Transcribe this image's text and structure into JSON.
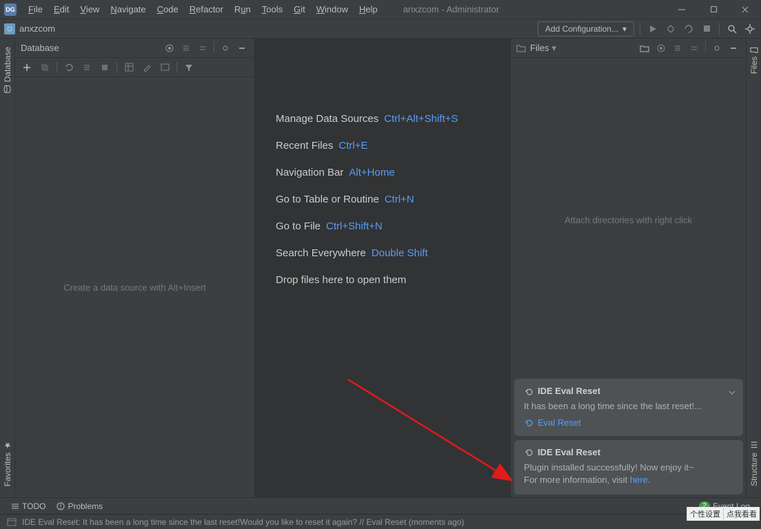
{
  "app_icon_text": "DG",
  "title": "anxzcom - Administrator",
  "menu": [
    "File",
    "Edit",
    "View",
    "Navigate",
    "Code",
    "Refactor",
    "Run",
    "Tools",
    "Git",
    "Window",
    "Help"
  ],
  "project_name": "anxzcom",
  "toolbar": {
    "config": "Add Configuration..."
  },
  "left_rail": {
    "database": "Database",
    "favorites": "Favorites"
  },
  "right_rail": {
    "files": "Files",
    "structure": "Structure"
  },
  "db_panel": {
    "title": "Database",
    "placeholder": "Create a data source with Alt+Insert"
  },
  "files_panel": {
    "title": "Files",
    "placeholder": "Attach directories with right click"
  },
  "tips": [
    {
      "label": "Manage Data Sources",
      "shortcut": "Ctrl+Alt+Shift+S"
    },
    {
      "label": "Recent Files",
      "shortcut": "Ctrl+E"
    },
    {
      "label": "Navigation Bar",
      "shortcut": "Alt+Home"
    },
    {
      "label": "Go to Table or Routine",
      "shortcut": "Ctrl+N"
    },
    {
      "label": "Go to File",
      "shortcut": "Ctrl+Shift+N"
    },
    {
      "label": "Search Everywhere",
      "shortcut": "Double Shift"
    },
    {
      "label": "Drop files here to open them",
      "shortcut": ""
    }
  ],
  "notifications": [
    {
      "title": "IDE Eval Reset",
      "body": "It has been a long time since the last reset!...",
      "action": "Eval Reset"
    },
    {
      "title": "IDE Eval Reset",
      "body1": "Plugin installed successfully! Now enjoy it~",
      "body2_prefix": "For more information, visit ",
      "body2_link": "here",
      "body2_suffix": "."
    }
  ],
  "bottom": {
    "todo": "TODO",
    "problems": "Problems",
    "event_log": "Event Log",
    "event_badge": "2"
  },
  "status": "IDE Eval Reset: It has been a long time since the last reset!Would you like to reset it again? // Eval Reset (moments ago)",
  "ext": {
    "a": "个性设置",
    "b": "点我看看"
  }
}
